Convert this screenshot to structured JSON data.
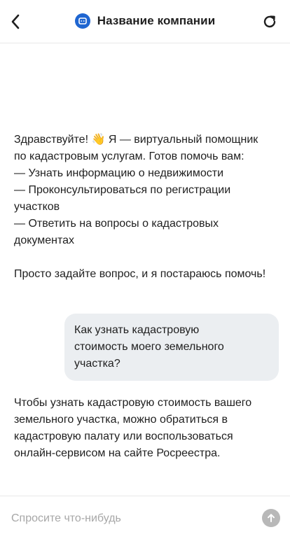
{
  "header": {
    "title": "Название компании",
    "back_icon": "chevron-left-icon",
    "refresh_icon": "refresh-icon",
    "logo_icon": "chat-bot-logo-icon",
    "brand_color": "#1f66d1"
  },
  "messages": [
    {
      "role": "bot",
      "lines": [
        "Здравствуйте! 👋 Я — виртуальный помощник по кадастровым услугам. Готов помочь вам:",
        "— Узнать информацию о недвижимости",
        "— Проконсультироваться по регистрации участков",
        "— Ответить на вопросы о кадастровых документах"
      ],
      "footer": "Просто задайте вопрос, и я постараюсь помочь!"
    },
    {
      "role": "user",
      "text": "Как узнать кадастровую стоимость моего земельного участка?"
    },
    {
      "role": "bot",
      "text": "Чтобы узнать кадастровую стоимость вашего земельного участка, можно обратиться в кадастровую палату или воспользоваться онлайн-сервисом на сайте Росреестра."
    }
  ],
  "composer": {
    "placeholder": "Спросите что-нибудь",
    "value": "",
    "send_icon": "arrow-up-icon"
  }
}
